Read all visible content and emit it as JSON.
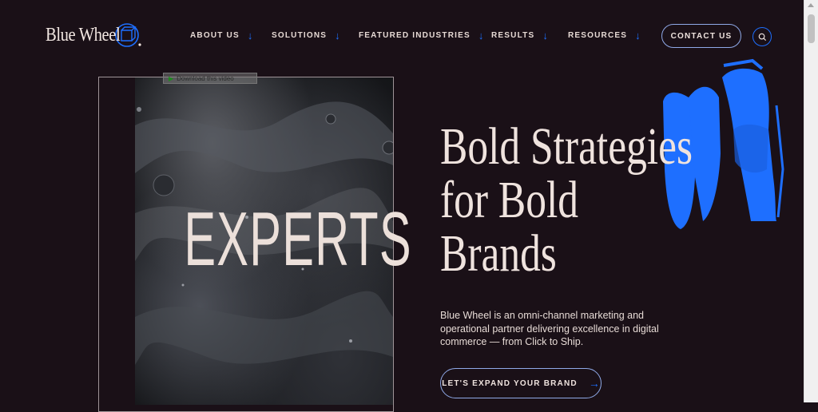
{
  "header": {
    "logo_text": "Blue Wheel",
    "nav": [
      {
        "label": "ABOUT US",
        "icon": "arrow-down-icon"
      },
      {
        "label": "SOLUTIONS",
        "icon": "arrow-down-icon"
      },
      {
        "label": "FEATURED INDUSTRIES",
        "icon": "arrow-down-icon"
      },
      {
        "label": "RESULTS",
        "icon": "arrow-down-icon"
      },
      {
        "label": "RESOURCES",
        "icon": "arrow-down-icon"
      }
    ],
    "contact_label": "CONTACT US",
    "search_icon": "search-icon"
  },
  "video": {
    "download_label": "Download this video",
    "overlay_word": "EXPERTS"
  },
  "hero": {
    "headline_lines": [
      "Bold Strategies",
      "for Bold",
      "Brands"
    ],
    "subtext": "Blue Wheel is an omni-channel marketing and operational partner delivering excellence in digital commerce — from Click to Ship.",
    "cta_label": "LET'S EXPAND YOUR BRAND",
    "cta_icon": "arrow-right-icon"
  },
  "colors": {
    "background": "#1a1017",
    "accent_blue": "#1e6fff",
    "text_cream": "#efe3de"
  }
}
